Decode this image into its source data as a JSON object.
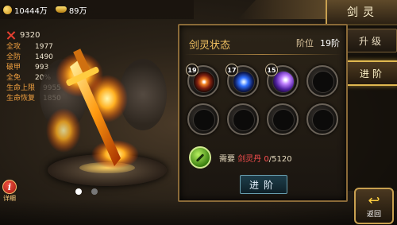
{
  "currency": {
    "gold": "10444万",
    "ingot": "89万"
  },
  "header": {
    "title": "剑灵"
  },
  "side_tabs": [
    {
      "label": "升级",
      "active": false
    },
    {
      "label": "进阶",
      "active": true
    }
  ],
  "stats": {
    "power": "9320",
    "rows": [
      {
        "label": "全攻",
        "value": "1977"
      },
      {
        "label": "全防",
        "value": "1490"
      },
      {
        "label": "破甲",
        "value": "993"
      },
      {
        "label": "全免",
        "value": "20%"
      },
      {
        "label": "生命上限",
        "value": "9955"
      },
      {
        "label": "生命恢复",
        "value": "1850"
      }
    ]
  },
  "detail": {
    "label": "详细"
  },
  "pager": {
    "count": 2,
    "active": 0
  },
  "panel": {
    "title": "剑灵状态",
    "rank_label": "阶位",
    "rank_value": "19阶",
    "slots": [
      {
        "level": "19",
        "gem": "gem-a",
        "filled": true
      },
      {
        "level": "17",
        "gem": "gem-b",
        "filled": true
      },
      {
        "level": "15",
        "gem": "gem-c",
        "filled": true
      },
      {
        "level": "",
        "gem": "",
        "filled": false
      },
      {
        "level": "",
        "gem": "",
        "filled": false
      },
      {
        "level": "",
        "gem": "",
        "filled": false
      },
      {
        "level": "",
        "gem": "",
        "filled": false
      },
      {
        "level": "",
        "gem": "",
        "filled": false
      }
    ],
    "requirement": {
      "prefix": "需要",
      "item": "剑灵丹",
      "have": "0",
      "need": "/5120"
    },
    "advance_button": "进阶"
  },
  "return_button": "返回",
  "colors": {
    "accent": "#e0b850",
    "highlight_red": "#ff5050",
    "stat_label": "#f0a040"
  }
}
